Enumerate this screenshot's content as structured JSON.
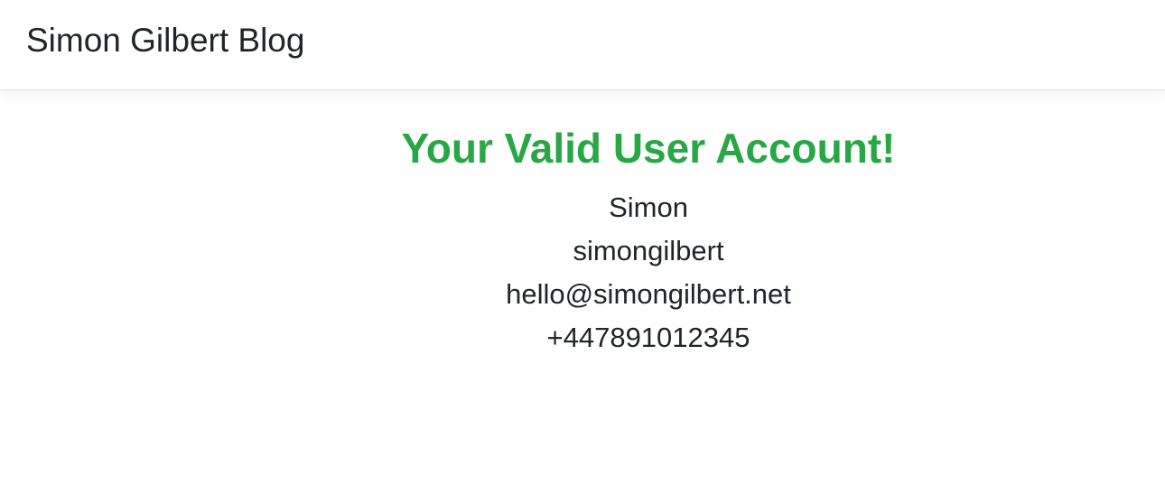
{
  "navbar": {
    "brand": "Simon Gilbert Blog"
  },
  "main": {
    "heading": "Your Valid User Account!",
    "user": {
      "name": "Simon",
      "username": "simongilbert",
      "email": "hello@simongilbert.net",
      "phone": "+447891012345"
    }
  },
  "colors": {
    "heading_green": "#28a745",
    "text": "#212529",
    "background": "#ffffff"
  }
}
